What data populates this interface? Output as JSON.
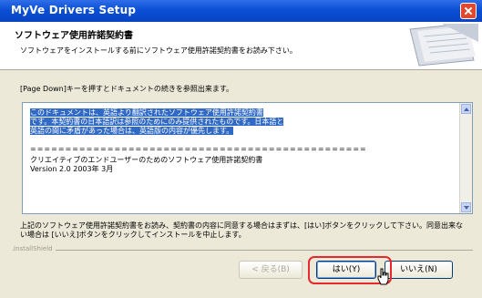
{
  "window": {
    "title": "MyVe Drivers Setup",
    "close_icon": "close-icon"
  },
  "header": {
    "title": "ソフトウェア使用許諾契約書",
    "subtitle": "ソフトウェアをインストールする前にソフトウェア使用許諾契約書をお読み下さい。"
  },
  "hint": "[Page Down]キーを押すとドキュメントの続きを参照出来ます。",
  "license": {
    "highlighted_lines": [
      "このドキュメントは、英語より翻訳されたソフトウェア使用許諾契約書",
      "です。本契約書の日本語訳は参照のためにのみ提供されたものです。日本語と",
      "英語の間に矛盾があった場合は、英語版の内容が優先します。"
    ],
    "separator": "================================================",
    "title_line": "クリエイティブのエンドユーザーのためのソフトウェア使用許諾契約書",
    "version_line": "Version 2.0 2003年 3月"
  },
  "accept_text": "上記のソフトウェア使用許諾契約書をお読み、契約書の内容に同意する場合はまずは、[はい]ボタンをクリックして下さい。同意出来ない場合は [いいえ]ボタンをクリックしてインストールを中止します。",
  "brand": "InstallShield",
  "buttons": {
    "back": "< 戻る(B)",
    "yes": "はい(Y)",
    "no": "いいえ(N)"
  },
  "colors": {
    "titlebar": "#0b4fd6",
    "highlight_ring": "#e8282c",
    "selection": "#316ac5"
  }
}
